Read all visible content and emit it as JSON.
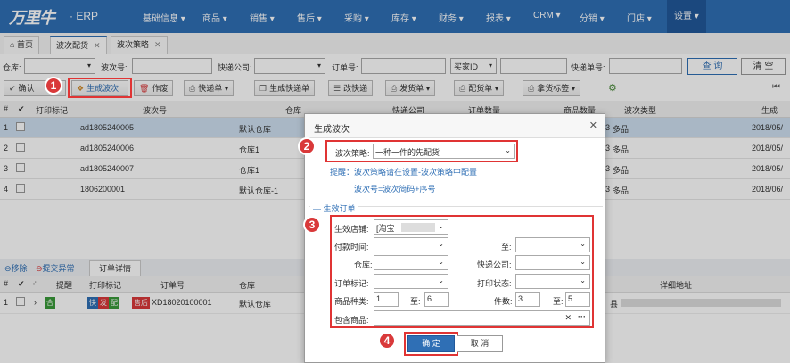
{
  "app": {
    "logo": "万里牛",
    "logo_sub": "· ERP"
  },
  "nav": [
    "基础信息",
    "商品",
    "销售",
    "售后",
    "采购",
    "库存",
    "财务",
    "报表",
    "CRM",
    "分销",
    "门店",
    "设置"
  ],
  "tabs": [
    {
      "label": "首页"
    },
    {
      "label": "波次配货"
    },
    {
      "label": "波次策略"
    }
  ],
  "filters": {
    "warehouse": "仓库:",
    "wave_no": "波次号:",
    "express": "快递公司:",
    "order_no": "订单号:",
    "buyer_id": "买家ID",
    "express_no": "快递单号:",
    "query": "查 询",
    "clear": "清 空"
  },
  "toolbar": {
    "confirm": "确认",
    "generate_wave": "生成波次",
    "void": "作废",
    "express_bill": "快递单",
    "gen_express": "生成快递单",
    "change_express": "改快递",
    "ship_bill": "发货单",
    "pick_bill": "配货单",
    "pick_tag": "拿货标签"
  },
  "grid": {
    "headers": [
      "打印标记",
      "波次号",
      "仓库",
      "快递公司",
      "订单数量",
      "商品数量",
      "波次类型",
      "生成"
    ],
    "rows": [
      {
        "idx": "1",
        "wave": "ad1805240005",
        "warehouse": "默认仓库",
        "qty": "3",
        "type": "多品",
        "date": "2018/05/"
      },
      {
        "idx": "2",
        "wave": "ad1805240006",
        "warehouse": "仓库1",
        "qty": "3",
        "type": "多品",
        "date": "2018/05/"
      },
      {
        "idx": "3",
        "wave": "ad1805240007",
        "warehouse": "仓库1",
        "qty": "3",
        "type": "多品",
        "date": "2018/05/"
      },
      {
        "idx": "4",
        "wave": "1806200001",
        "warehouse": "默认仓库-1",
        "qty": "3",
        "type": "多品",
        "date": "2018/06/"
      }
    ]
  },
  "subpanel": {
    "remove": "移除",
    "report": "提交异常",
    "tab": "订单详情",
    "headers": [
      "提醒",
      "打印标记",
      "订单号",
      "仓库",
      "详细地址"
    ],
    "row": {
      "idx": "1",
      "remind": "合",
      "p1": "快",
      "p2": "发",
      "p3": "配",
      "aftersale": "售后",
      "order_no": "XD18020100001",
      "warehouse": "默认仓库",
      "addr_tail": "县"
    }
  },
  "dialog": {
    "title": "生成波次",
    "strategy_label": "波次策略:",
    "strategy_value": "一种一件的先配货",
    "hint1": "提醒：波次策略请在设置-波次策略中配置",
    "hint2": "波次号=波次简码+序号",
    "section": "生效订单",
    "shop_label": "生效店铺:",
    "shop_value": "[淘宝",
    "pay_time": "付款时间:",
    "to": "至:",
    "warehouse": "仓库:",
    "express": "快递公司:",
    "order_mark": "订单标记:",
    "print_status": "打印状态:",
    "sku_kinds": "商品种类:",
    "sku_from": "1",
    "to_short": "至:",
    "sku_to": "6",
    "pieces": "件数:",
    "pieces_from": "3",
    "pieces_to": "5",
    "contains": "包含商品:",
    "ok": "确 定",
    "cancel": "取 消"
  },
  "steps": [
    "1",
    "2",
    "3",
    "4"
  ],
  "colors": {
    "nav": "#2f6fb5",
    "highlight": "#e03434",
    "step": "#d9393a"
  }
}
